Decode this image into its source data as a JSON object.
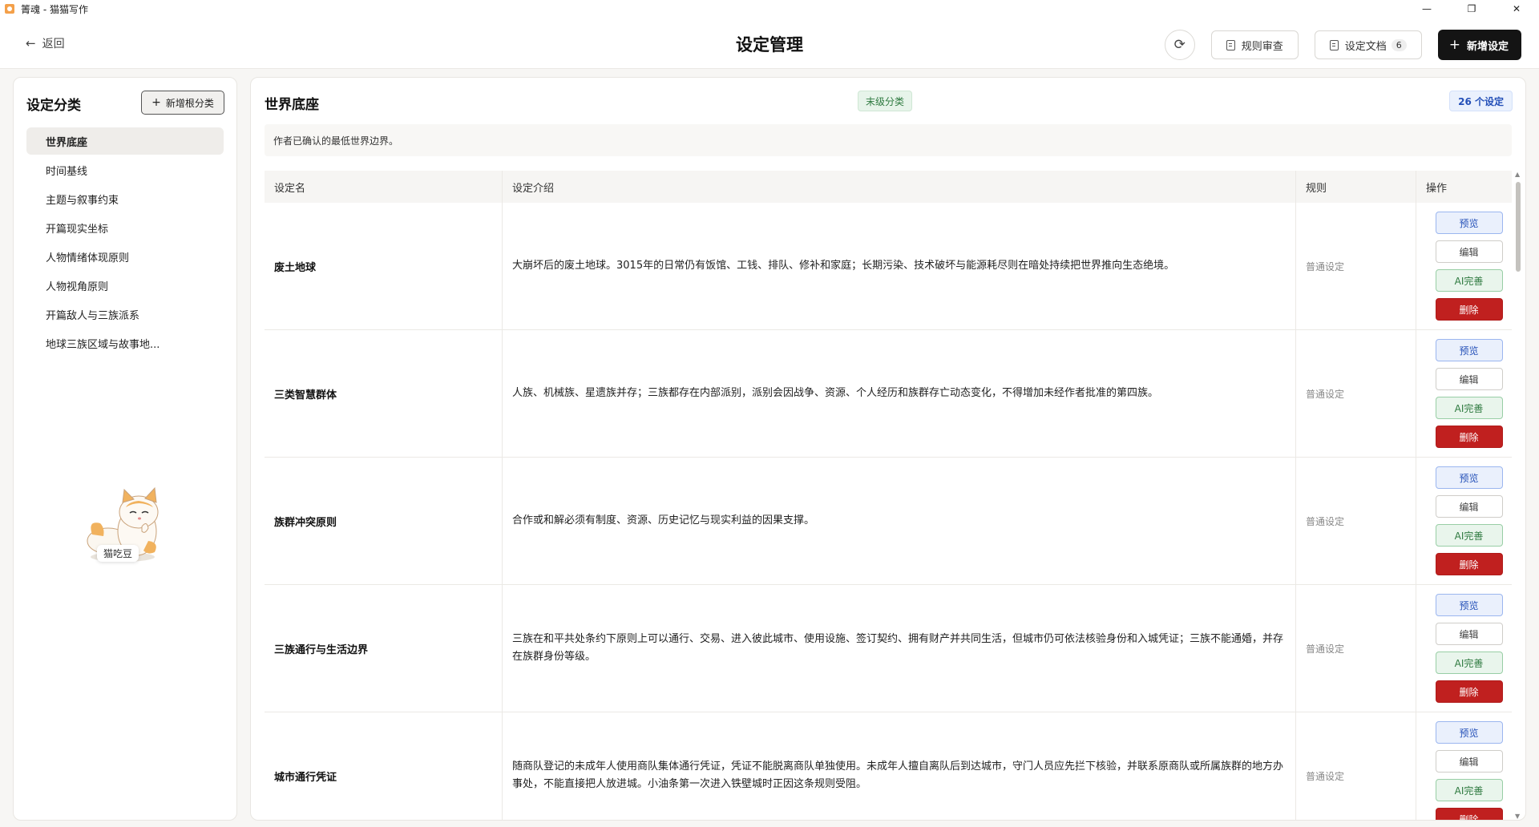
{
  "window": {
    "title": "箐魂 - 猫猫写作",
    "minimize": "—",
    "maximize": "❐",
    "close": "✕"
  },
  "header": {
    "back_label": "返回",
    "back_icon": "←",
    "page_title": "设定管理",
    "refresh_icon": "⟳",
    "rule_review_label": "规则审查",
    "settings_doc_label": "设定文档",
    "settings_doc_count": "6",
    "add_setting_label": "新增设定",
    "plus_icon": "+"
  },
  "sidebar": {
    "title": "设定分类",
    "add_root_label": "新增根分类",
    "categories": [
      {
        "label": "世界底座",
        "active": true
      },
      {
        "label": "时间基线"
      },
      {
        "label": "主题与叙事约束"
      },
      {
        "label": "开篇现实坐标"
      },
      {
        "label": "人物情绪体现原则"
      },
      {
        "label": "人物视角原则"
      },
      {
        "label": "开篇敌人与三族派系"
      },
      {
        "label": "地球三族区域与故事地..."
      }
    ],
    "mascot_label": "猫吃豆"
  },
  "main": {
    "title": "世界底座",
    "level_badge": "末级分类",
    "count_tag": "26 个设定",
    "description": "作者已确认的最低世界边界。",
    "columns": [
      "设定名",
      "设定介绍",
      "规则",
      "操作"
    ],
    "actions": {
      "preview": "预览",
      "edit": "编辑",
      "ai": "AI完善",
      "delete": "删除"
    },
    "rows": [
      {
        "name": "废土地球",
        "intro": "大崩坏后的废土地球。3015年的日常仍有饭馆、工钱、排队、修补和家庭；长期污染、技术破坏与能源耗尽则在暗处持续把世界推向生态绝境。",
        "rule": "普通设定"
      },
      {
        "name": "三类智慧群体",
        "intro": "人族、机械族、星遗族并存；三族都存在内部派别，派别会因战争、资源、个人经历和族群存亡动态变化，不得增加未经作者批准的第四族。",
        "rule": "普通设定"
      },
      {
        "name": "族群冲突原则",
        "intro": "合作或和解必须有制度、资源、历史记忆与现实利益的因果支撑。",
        "rule": "普通设定"
      },
      {
        "name": "三族通行与生活边界",
        "intro": "三族在和平共处条约下原则上可以通行、交易、进入彼此城市、使用设施、签订契约、拥有财产并共同生活，但城市仍可依法核验身份和入城凭证；三族不能通婚，并存在族群身份等级。",
        "rule": "普通设定"
      },
      {
        "name": "城市通行凭证",
        "intro": "随商队登记的未成年人使用商队集体通行凭证，凭证不能脱离商队单独使用。未成年人擅自离队后到达城市，守门人员应先拦下核验，并联系原商队或所属族群的地方办事处，不能直接把人放进城。小油条第一次进入铁壁城时正因这条规则受阻。",
        "rule": "普通设定"
      }
    ]
  }
}
